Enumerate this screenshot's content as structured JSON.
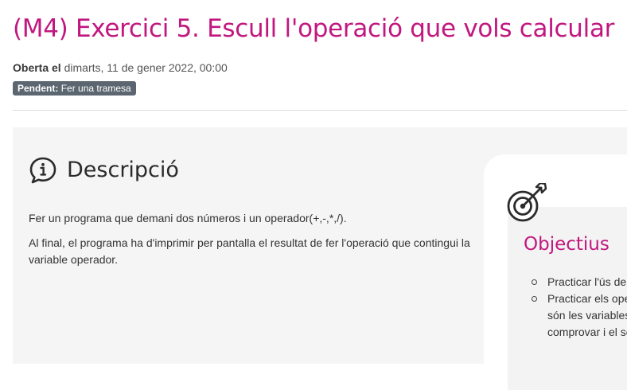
{
  "page": {
    "title": "(M4) Exercici 5. Escull l'operació que vols calcular"
  },
  "dates": {
    "opened_label": "Oberta el",
    "opened_value": "dimarts, 11 de gener 2022, 00:00"
  },
  "status": {
    "label": "Pendent:",
    "value": "Fer una tramesa"
  },
  "description": {
    "icon": "info-speech-bubble-icon",
    "heading": "Descripció",
    "paragraphs": [
      "Fer un programa que demani dos números i un operador(+,-,*,/).",
      "Al final, el programa ha d'imprimir per pantalla el resultat de fer l'operació que contingui la variable operador."
    ]
  },
  "objectives": {
    "icon": "target-arrow-icon",
    "title": "Objectius",
    "items": [
      "Practicar l'ús de condicionals.",
      "Practicar els operadors, quines són les variables s'han de comprovar i el seu"
    ]
  },
  "colors": {
    "accent": "#c1177f",
    "badge_bg": "#5b6670",
    "panel_bg": "#f5f5f5"
  }
}
